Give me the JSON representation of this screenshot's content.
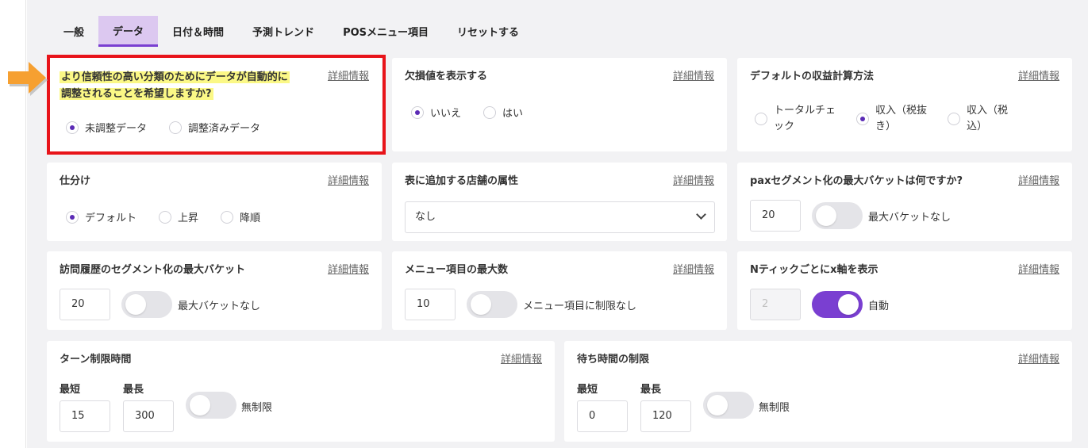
{
  "tabs": [
    "一般",
    "データ",
    "日付＆時間",
    "予測トレンド",
    "POSメニュー項目",
    "リセットする"
  ],
  "detail_link": "詳細情報",
  "colors": {
    "accent": "#7a3fd1",
    "active_tab_bg": "#dcc8f0",
    "highlight_box": "#e8141a",
    "highlight_text_bg": "#fbf886",
    "arrow": "#f6a031"
  },
  "cards": {
    "adjust": {
      "title_line1": "より信頼性の高い分類のためにデータが自動的に",
      "title_line2": "調整されることを希望しますか?",
      "options": [
        "未調整データ",
        "調整済みデータ"
      ],
      "selected": 0
    },
    "missing": {
      "title": "欠損値を表示する",
      "options": [
        "いいえ",
        "はい"
      ],
      "selected": 0
    },
    "revenue": {
      "title": "デフォルトの収益計算方法",
      "options": [
        {
          "line1": "トータルチェ",
          "line2": "ック"
        },
        {
          "line1": "収入（税抜",
          "line2": "き）"
        },
        {
          "line1": "収入（税",
          "line2": "込）"
        }
      ],
      "selected": 1
    },
    "sort": {
      "title": "仕分け",
      "options": [
        "デフォルト",
        "上昇",
        "降順"
      ],
      "selected": 0
    },
    "store_attr": {
      "title": "表に追加する店舗の属性",
      "value": "なし"
    },
    "pax": {
      "title": "paxセグメント化の最大バケットは何ですか?",
      "value": "20",
      "toggle_label": "最大バケットなし",
      "toggle_on": false
    },
    "visit": {
      "title": "訪問履歴のセグメント化の最大バケット",
      "value": "20",
      "toggle_label": "最大バケットなし",
      "toggle_on": false
    },
    "menu_max": {
      "title": "メニュー項目の最大数",
      "value": "10",
      "toggle_label": "メニュー項目に制限なし",
      "toggle_on": false
    },
    "xaxis": {
      "title": "Nティックごとにx軸を表示",
      "value": "2",
      "toggle_label": "自動",
      "toggle_on": true
    },
    "turn": {
      "title": "ターン制限時間",
      "min_label": "最短",
      "max_label": "最長",
      "min_value": "15",
      "max_value": "300",
      "toggle_label": "無制限",
      "toggle_on": false
    },
    "wait": {
      "title": "待ち時間の制限",
      "min_label": "最短",
      "max_label": "最長",
      "min_value": "0",
      "max_value": "120",
      "toggle_label": "無制限",
      "toggle_on": false
    }
  }
}
